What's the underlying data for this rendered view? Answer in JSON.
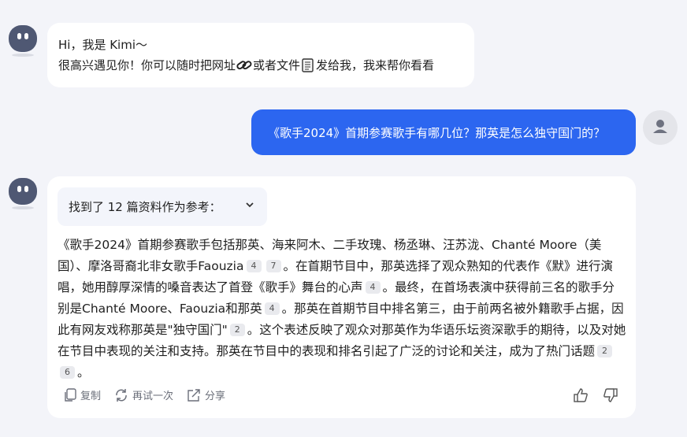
{
  "greeting": {
    "line1": "Hi，我是 Kimi～",
    "line2_a": "很高兴遇见你！你可以随时把网址",
    "line2_b": "或者文件",
    "line2_c": "发给我，我来帮你看看"
  },
  "user_message": "《歌手2024》首期参赛歌手有哪几位？那英是怎么独守国门的？",
  "references": {
    "label": "找到了 12 篇资料作为参考："
  },
  "answer": {
    "segments": [
      {
        "text": "《歌手2024》首期参赛歌手包括那英、海来阿木、二手玫瑰、杨丞琳、汪苏泷、Chanté Moore（美国）、摩洛哥裔北非女歌手Faouzia"
      },
      {
        "cite": "4"
      },
      {
        "cite": "7"
      },
      {
        "text": "。在首期节目中，那英选择了观众熟知的代表作《默》进行演唱，她用醇厚深情的嗓音表达了首登《歌手》舞台的心声"
      },
      {
        "cite": "4"
      },
      {
        "text": "。最终，在首场表演中获得前三名的歌手分别是Chanté Moore、Faouzia和那英"
      },
      {
        "cite": "4"
      },
      {
        "text": "。那英在首期节目中排名第三，由于前两名被外籍歌手占据，因此有网友戏称那英是\"独守国门\""
      },
      {
        "cite": "2"
      },
      {
        "text": "。这个表述反映了观众对那英作为华语乐坛资深歌手的期待，以及对她在节目中表现的关注和支持。那英在节目中的表现和排名引起了广泛的讨论和关注，成为了热门话题"
      },
      {
        "cite": "2"
      },
      {
        "cite": "6"
      },
      {
        "text": "。"
      }
    ]
  },
  "actions": {
    "copy": "复制",
    "retry": "再试一次",
    "share": "分享"
  },
  "icons": [
    "kimi-avatar-icon",
    "link-icon",
    "document-icon",
    "user-icon",
    "chevron-down-icon",
    "copy-icon",
    "retry-icon",
    "share-icon",
    "thumbs-up-icon",
    "thumbs-down-icon"
  ],
  "colors": {
    "background": "#f3f4f9",
    "user_bubble": "#2c66f0",
    "avatar": "#4f5873",
    "reference_box": "#f3f5fb"
  }
}
